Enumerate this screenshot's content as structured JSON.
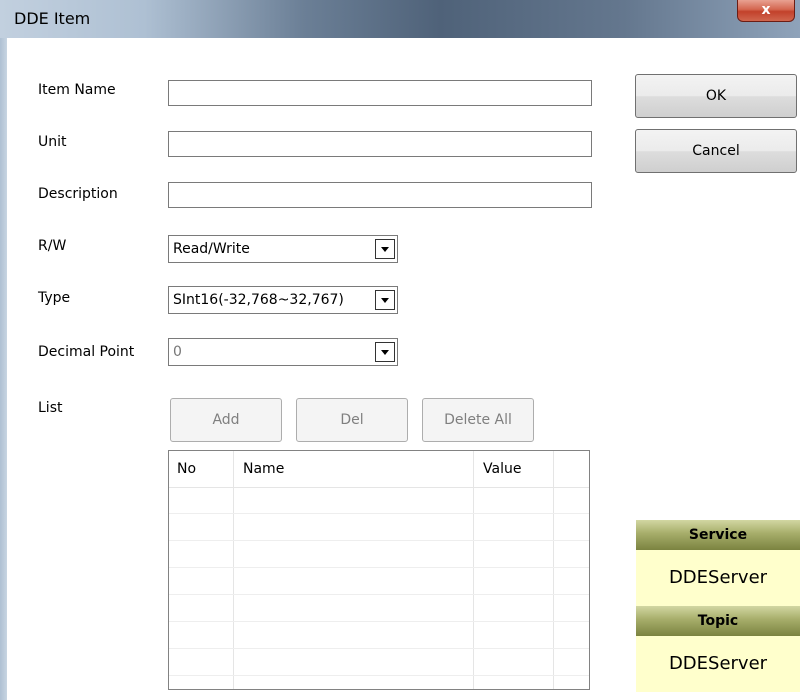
{
  "window": {
    "title": "DDE Item",
    "close_label": "x"
  },
  "form": {
    "item_name_label": "Item Name",
    "item_name_value": "",
    "unit_label": "Unit",
    "unit_value": "",
    "description_label": "Description",
    "description_value": "",
    "rw_label": "R/W",
    "rw_value": "Read/Write",
    "type_label": "Type",
    "type_value": "SInt16(-32,768~32,767)",
    "decimal_label": "Decimal Point",
    "decimal_value": "0",
    "list_label": "List"
  },
  "buttons": {
    "ok": "OK",
    "cancel": "Cancel",
    "add": "Add",
    "del": "Del",
    "delete_all": "Delete All"
  },
  "list": {
    "columns": [
      "No",
      "Name",
      "Value"
    ],
    "rows": []
  },
  "panel": {
    "service_label": "Service",
    "service_value": "DDEServer",
    "topic_label": "Topic",
    "topic_value": "DDEServer"
  },
  "colors": {
    "panel_header": "#a6ad6a",
    "panel_value_bg": "#ffffcc",
    "close_button": "#c2412b"
  }
}
